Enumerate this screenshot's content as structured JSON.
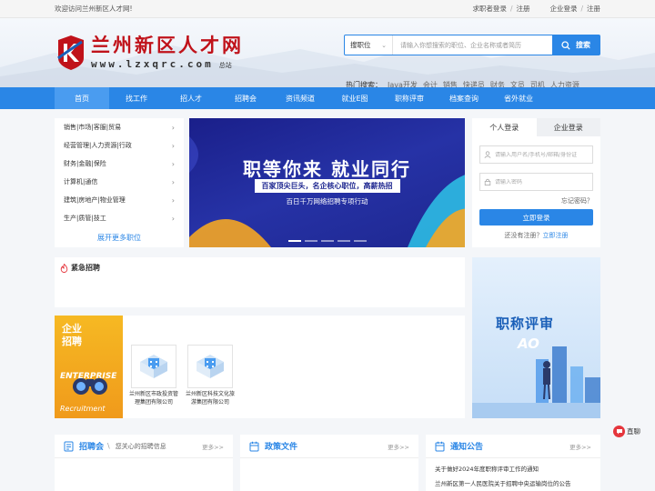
{
  "topbar": {
    "welcome": "欢迎访问兰州新区人才网!",
    "seeker_login": "求职者登录",
    "seeker_register": "注册",
    "company_login": "企业登录",
    "company_register": "注册",
    "sep": "/"
  },
  "logo": {
    "title": "兰州新区人才网",
    "url": "www.lzxqrc.com",
    "station": "总站"
  },
  "search": {
    "type": "搜职位",
    "placeholder": "请输入你想搜索的职位、企业名称或者简历",
    "button": "搜索"
  },
  "hot": {
    "label": "热门搜索：",
    "items": [
      "Java开发",
      "会计",
      "销售",
      "快递员",
      "财务",
      "文员",
      "司机",
      "人力资源"
    ]
  },
  "nav": {
    "items": [
      "首页",
      "找工作",
      "招人才",
      "招聘会",
      "资讯频道",
      "就业E图",
      "职称评审",
      "档案查询",
      "省外就业"
    ]
  },
  "categories": {
    "items": [
      "销售|市场|客服|贸易",
      "经营管理|人力资源|行政",
      "财务|金融|保险",
      "计算机|通信",
      "建筑|房地产|物业管理",
      "生产|质管|技工"
    ],
    "more": "展开更多职位"
  },
  "banner": {
    "title": "职等你来 就业同行",
    "ribbon": "百家顶尖巨头，名企核心职位，高薪热招",
    "sub": "百日千万网络招聘专项行动"
  },
  "login": {
    "tab_personal": "个人登录",
    "tab_company": "企业登录",
    "user_placeholder": "请输入用户名/手机号/邮箱/身份证",
    "pwd_placeholder": "请输入密码",
    "forgot": "忘记密码？",
    "button": "立即登录",
    "no_account": "还没有注册？",
    "register": "立即注册"
  },
  "urgent": {
    "title": "紧急招聘"
  },
  "enterprise": {
    "cn": "企业招聘",
    "en1": "ENTERPRISE",
    "en2": "Recruitment",
    "companies": [
      "兰州新区市政投资管理集团有限公司",
      "兰州新区科技文化旅游集团有限公司"
    ]
  },
  "side_banner": {
    "title": "职称评审",
    "sub": "AO"
  },
  "sections": {
    "job_fair": {
      "title": "招聘会",
      "desc": "您关心的招聘信息",
      "more": "更多>>"
    },
    "policy": {
      "title": "政策文件",
      "more": "更多>>"
    },
    "notice": {
      "title": "通知公告",
      "more": "更多>>",
      "items": [
        "关于做好2024年度职称评审工作的通知",
        "兰州新区第一人民医院关于招聘中央运输岗位的公告"
      ]
    }
  },
  "live": {
    "label": "直聊"
  }
}
